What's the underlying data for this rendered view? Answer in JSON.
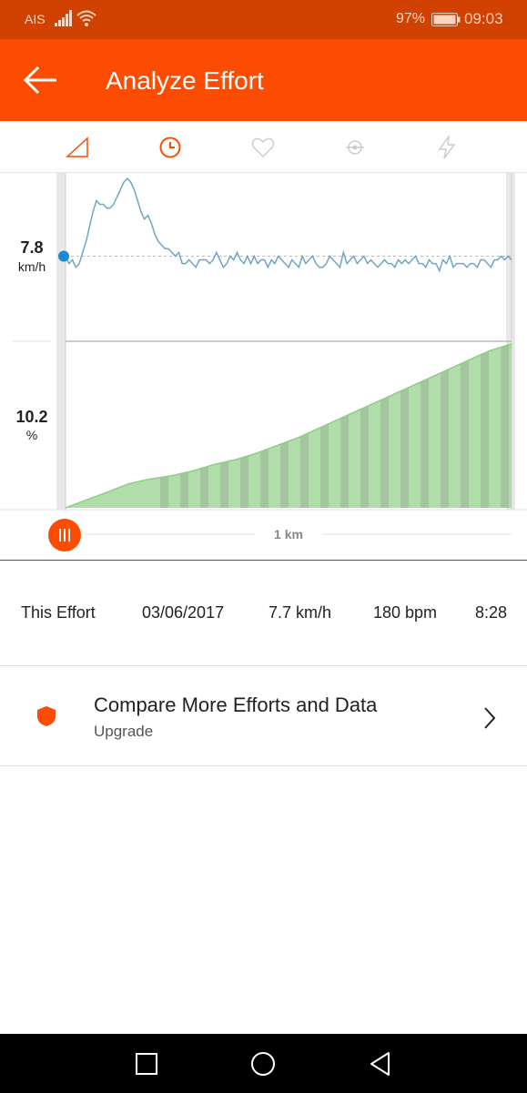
{
  "status_bar": {
    "carrier": "AIS",
    "battery_percent": "97%",
    "time": "09:03"
  },
  "header": {
    "title": "Analyze Effort"
  },
  "tabs": [
    {
      "name": "elevation",
      "icon": "elevation-icon",
      "active": false
    },
    {
      "name": "time",
      "icon": "clock-icon",
      "active": true
    },
    {
      "name": "heart-rate",
      "icon": "heart-icon",
      "active": false
    },
    {
      "name": "cadence",
      "icon": "cadence-icon",
      "active": false
    },
    {
      "name": "power",
      "icon": "lightning-icon",
      "active": false
    }
  ],
  "chart": {
    "speed_value": "7.8",
    "speed_unit": "km/h",
    "grade_value": "10.2",
    "grade_unit": "%",
    "distance_label": "1 km"
  },
  "chart_data": {
    "type": "line",
    "series": [
      {
        "values": [
          7.8,
          7.6,
          7.7,
          7.5,
          7.6,
          7.9,
          8.2,
          8.6,
          9.0,
          9.3,
          9.2,
          9.2,
          9.1,
          9.1,
          9.2,
          9.4,
          9.6,
          9.8,
          9.9,
          9.8,
          9.6,
          9.3,
          9.0,
          8.8,
          8.9,
          8.7,
          8.4,
          8.2,
          8.1,
          8.0,
          8.0,
          7.9,
          7.8,
          7.9,
          7.6,
          7.6,
          7.7,
          7.6,
          7.5,
          7.7,
          7.7,
          7.7,
          7.6,
          7.7,
          7.9,
          7.7,
          7.5,
          7.6,
          7.8,
          7.7,
          7.9,
          7.7,
          7.6,
          7.8,
          7.6,
          7.8,
          7.6,
          7.7,
          7.7,
          7.5,
          7.7,
          7.6,
          7.8,
          7.7,
          7.6,
          7.5,
          7.7,
          7.6,
          7.5,
          7.8,
          7.6,
          7.7,
          7.8,
          7.6,
          7.5,
          7.5,
          7.6,
          7.8,
          7.7,
          7.6,
          7.5,
          7.9,
          7.6,
          7.7,
          7.8,
          7.6,
          7.7,
          7.8,
          7.6,
          7.7,
          7.6,
          7.5,
          7.6,
          7.7,
          7.6,
          7.6,
          7.5,
          7.7,
          7.6,
          7.7,
          7.6,
          7.7,
          7.8,
          7.6,
          7.6,
          7.5,
          7.7,
          7.6,
          7.6,
          7.4,
          7.7,
          7.6,
          7.8,
          7.5,
          7.6,
          7.6,
          7.6,
          7.5,
          7.6,
          7.6,
          7.5,
          7.7,
          7.7,
          7.6,
          7.5,
          7.7,
          7.7,
          7.8,
          7.7,
          7.8,
          7.7
        ]
      },
      {
        "values": [
          0.0,
          0.5,
          1.0,
          1.5,
          1.8,
          2.0,
          2.3,
          2.7,
          3.0,
          3.4,
          3.9,
          4.4,
          5.0,
          5.6,
          6.2,
          6.8,
          7.4,
          8.0,
          8.6,
          9.2,
          9.8,
          10.2
        ]
      }
    ]
  },
  "effort": {
    "label": "This Effort",
    "date": "03/06/2017",
    "speed": "7.7 km/h",
    "heart_rate": "180 bpm",
    "time": "8:28"
  },
  "compare": {
    "title": "Compare More Efforts and Data",
    "subtitle": "Upgrade"
  },
  "nav": {
    "buttons": [
      "recent-apps-icon",
      "home-icon",
      "back-icon"
    ]
  },
  "colors": {
    "brand": "#fc4c02",
    "status_bar": "#d14100",
    "line": "#6fa6c4",
    "area": "#a9d9a2",
    "dot": "#1b8ad3"
  }
}
